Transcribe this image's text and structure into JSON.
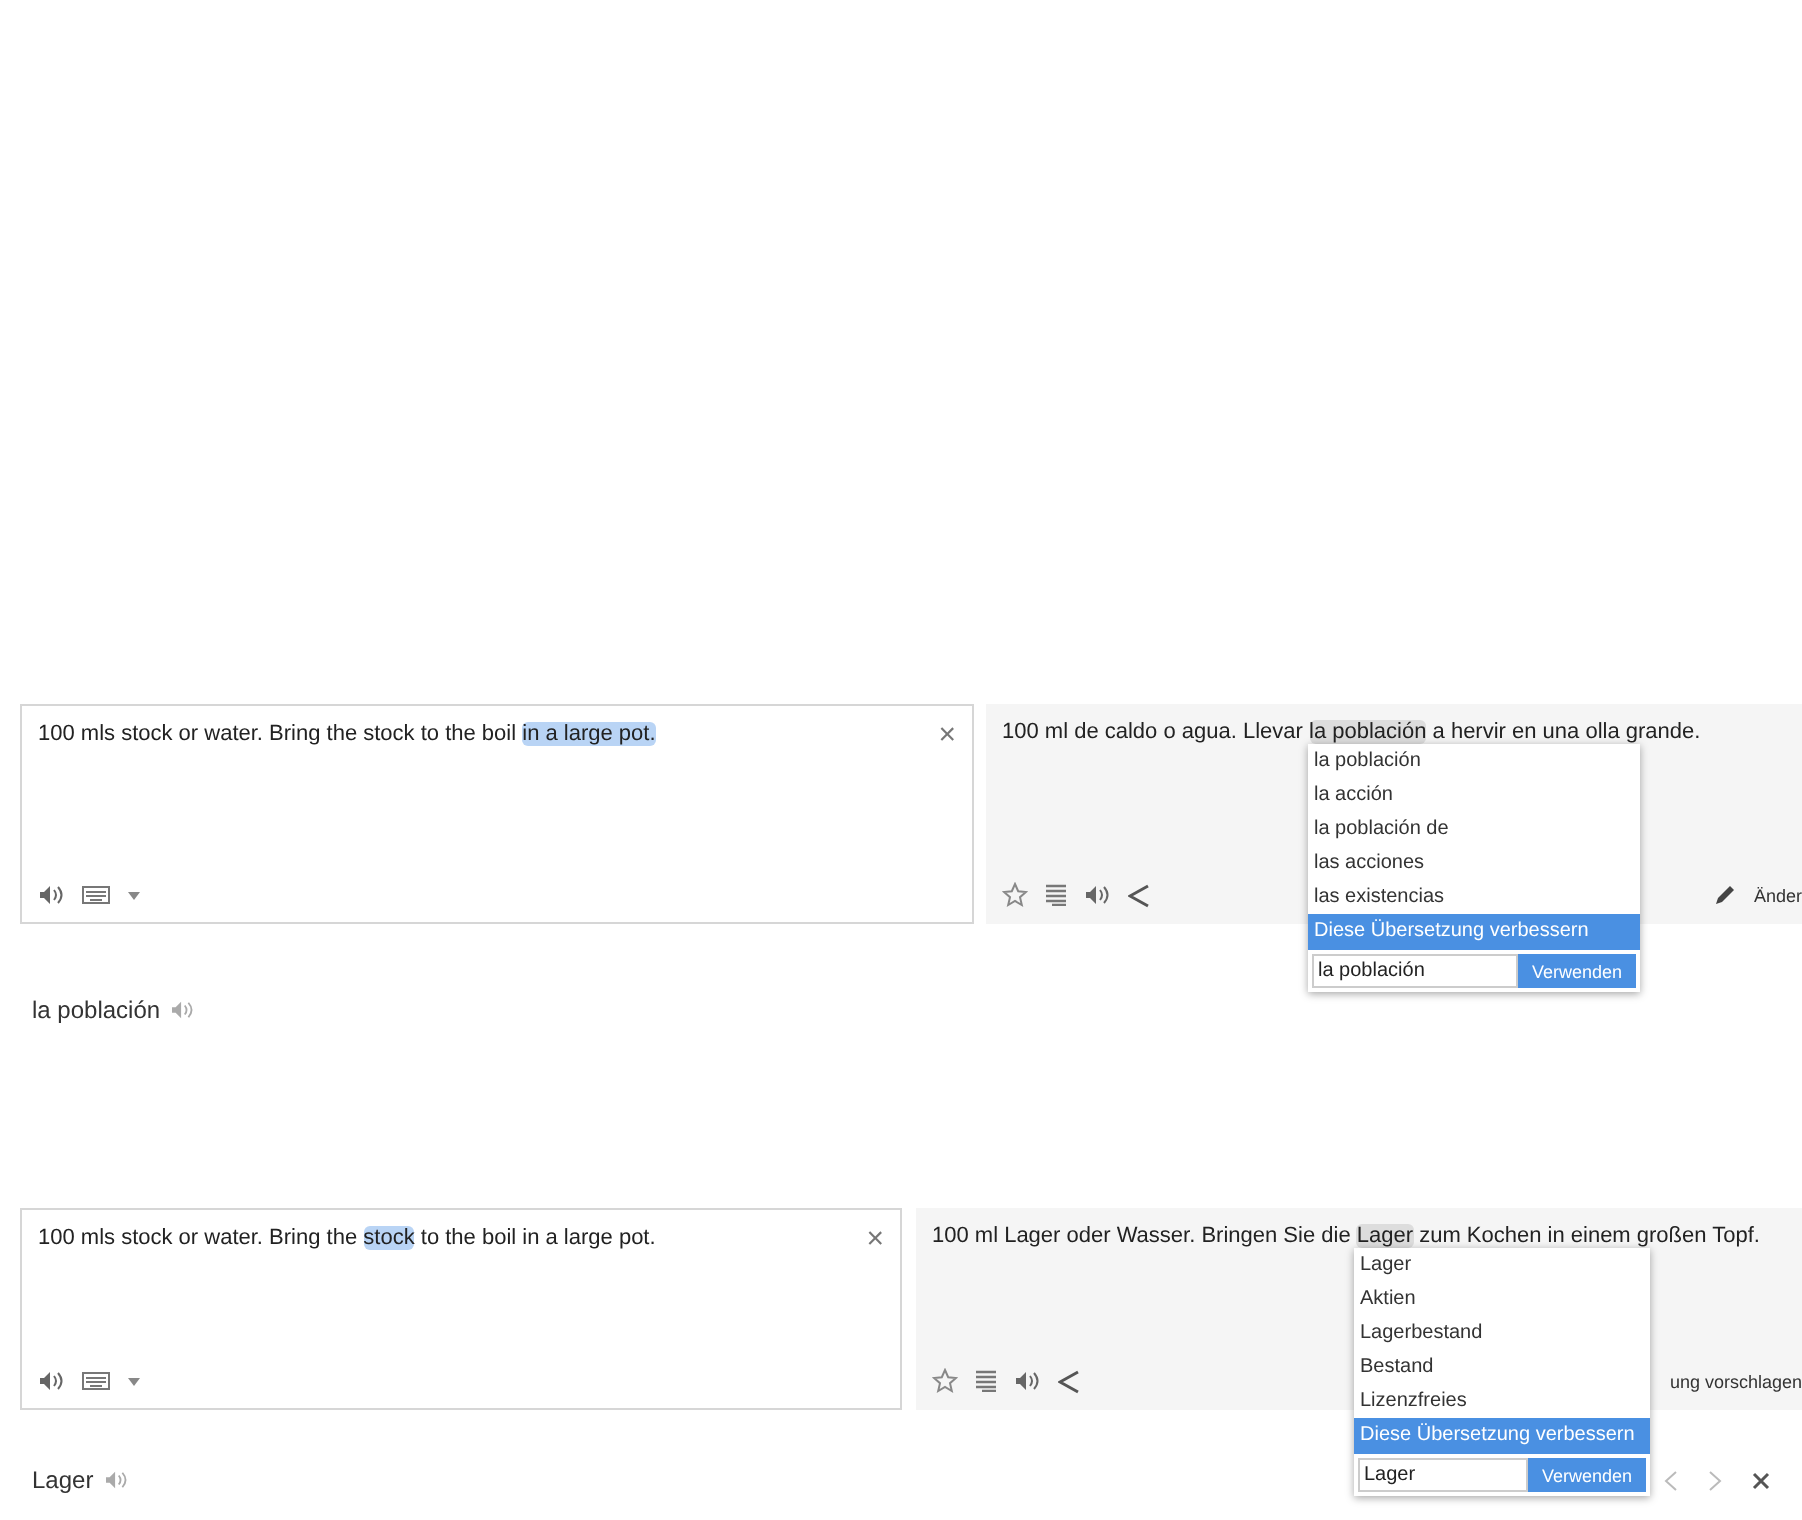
{
  "examples": [
    {
      "source": {
        "before": "100 mls stock or water. Bring the stock to the boil ",
        "highlight": "in a large pot."
      },
      "source_close": "×",
      "translation": {
        "before": "100 ml de caldo o agua. Llevar ",
        "highlight": "la población",
        "after": " a hervir en una olla grande."
      },
      "footer_action": "Änder",
      "footer_pencil": true,
      "alternatives": [
        "la población",
        "la acción",
        "la población de",
        "las acciones",
        "las existencias"
      ],
      "improve": "Diese Übersetzung verbessern",
      "edit_value": "la población",
      "use_button": "Verwenden",
      "word": "la población",
      "nav": false
    },
    {
      "source": {
        "before": "100 mls stock or water. Bring the ",
        "highlight": "stock",
        "after": " to the boil in a large pot."
      },
      "source_close": "×",
      "translation": {
        "before": "100 ml Lager oder Wasser. Bringen Sie die ",
        "highlight": "Lager",
        "after": " zum Kochen in einem großen Topf."
      },
      "footer_action": "ung vorschlagen",
      "footer_pencil": false,
      "alternatives": [
        "Lager",
        "Aktien",
        "Lagerbestand",
        "Bestand",
        "Lizenzfreies"
      ],
      "improve": "Diese Übersetzung verbessern",
      "edit_value": "Lager",
      "use_button": "Verwenden",
      "word": "Lager",
      "nav": true
    }
  ]
}
